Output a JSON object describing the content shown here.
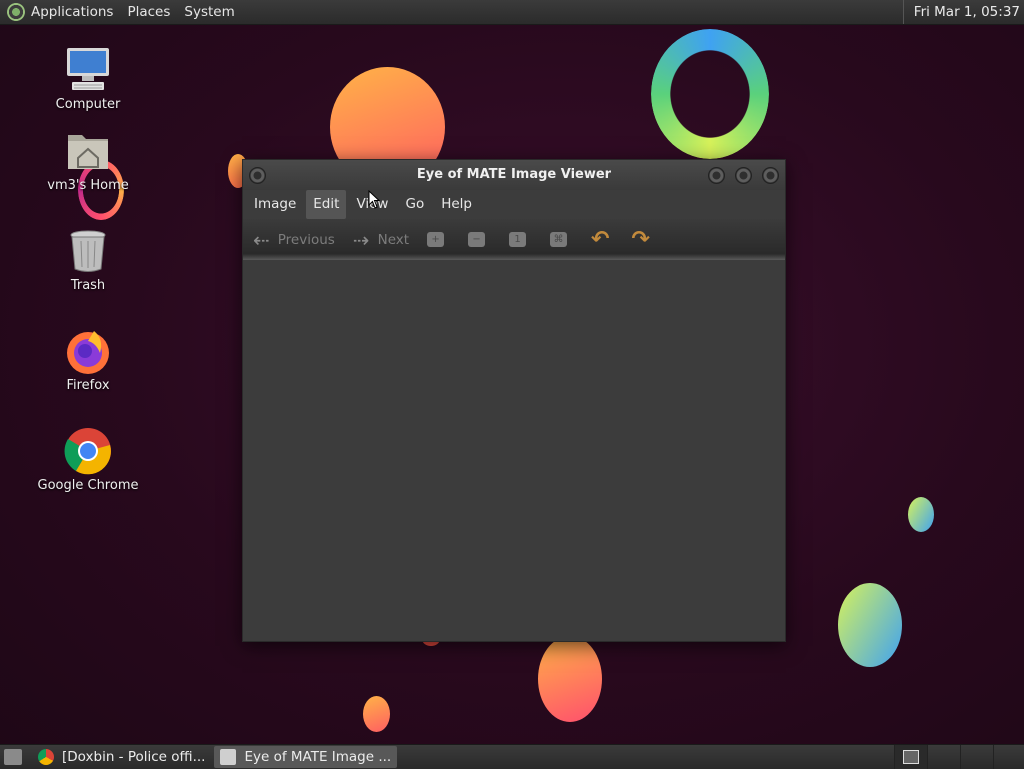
{
  "top_panel": {
    "menus": [
      "Applications",
      "Places",
      "System"
    ],
    "clock": "Fri Mar 1, 05:37"
  },
  "desktop_icons": [
    {
      "label": "Computer",
      "icon": "computer-icon"
    },
    {
      "label": "vm3's Home",
      "icon": "home-folder-icon"
    },
    {
      "label": "Trash",
      "icon": "trash-icon"
    },
    {
      "label": "Firefox",
      "icon": "firefox-icon"
    },
    {
      "label": "Google Chrome",
      "icon": "chrome-icon"
    }
  ],
  "window": {
    "title": "Eye of MATE Image Viewer",
    "menu": [
      "Image",
      "Edit",
      "View",
      "Go",
      "Help"
    ],
    "active_menu": "Edit",
    "toolbar": {
      "previous_label": "Previous",
      "next_label": "Next",
      "icons": [
        "zoom-in-icon",
        "zoom-out-icon",
        "normal-size-icon",
        "best-fit-icon",
        "rotate-left-icon",
        "rotate-right-icon"
      ]
    }
  },
  "taskbar": {
    "tasks": [
      {
        "label": "[Doxbin - Police offi...",
        "icon": "chrome-icon",
        "active": false
      },
      {
        "label": "Eye of MATE Image ...",
        "icon": "image-viewer-icon",
        "active": true
      }
    ]
  },
  "colors": {
    "desktop_bg": "#28091d",
    "panel_bg": "#2e2e2e",
    "window_bg": "#3c3c3c",
    "rotate_icon": "#c28a3c"
  }
}
